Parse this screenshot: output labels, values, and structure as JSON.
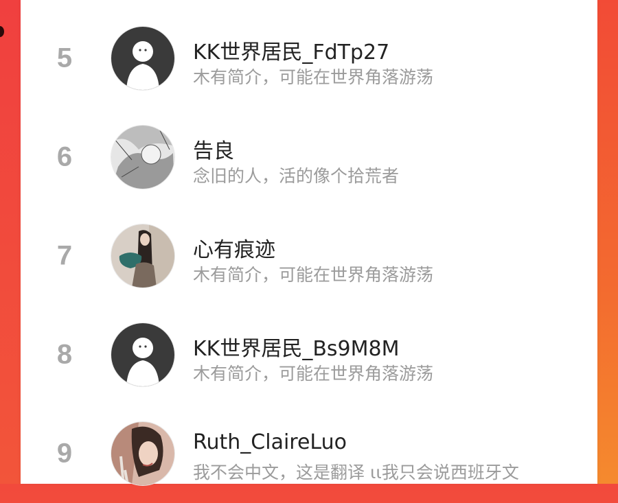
{
  "users": [
    {
      "rank": "5",
      "name": "KK世界居民_FdTp27",
      "bio": "木有简介，可能在世界角落游荡",
      "avatar_icon": "default-avatar-icon"
    },
    {
      "rank": "6",
      "name": "告良",
      "bio": "念旧的人，活的像个拾荒者",
      "avatar_icon": "sketch-avatar-photo"
    },
    {
      "rank": "7",
      "name": "心有痕迹",
      "bio": "木有简介，可能在世界角落游荡",
      "avatar_icon": "person-avatar-photo"
    },
    {
      "rank": "8",
      "name": "KK世界居民_Bs9M8M",
      "bio": "木有简介，可能在世界角落游荡",
      "avatar_icon": "default-avatar-icon"
    },
    {
      "rank": "9",
      "name": "Ruth_ClaireLuo",
      "bio": "我不会中文，这是翻译 ⍳⍳我只会说西班牙文",
      "avatar_icon": "portrait-avatar-photo"
    }
  ],
  "colors": {
    "rank": "#a9a9a9",
    "name": "#222222",
    "bio": "#9b9b9b",
    "accent": "#f24a3c"
  }
}
